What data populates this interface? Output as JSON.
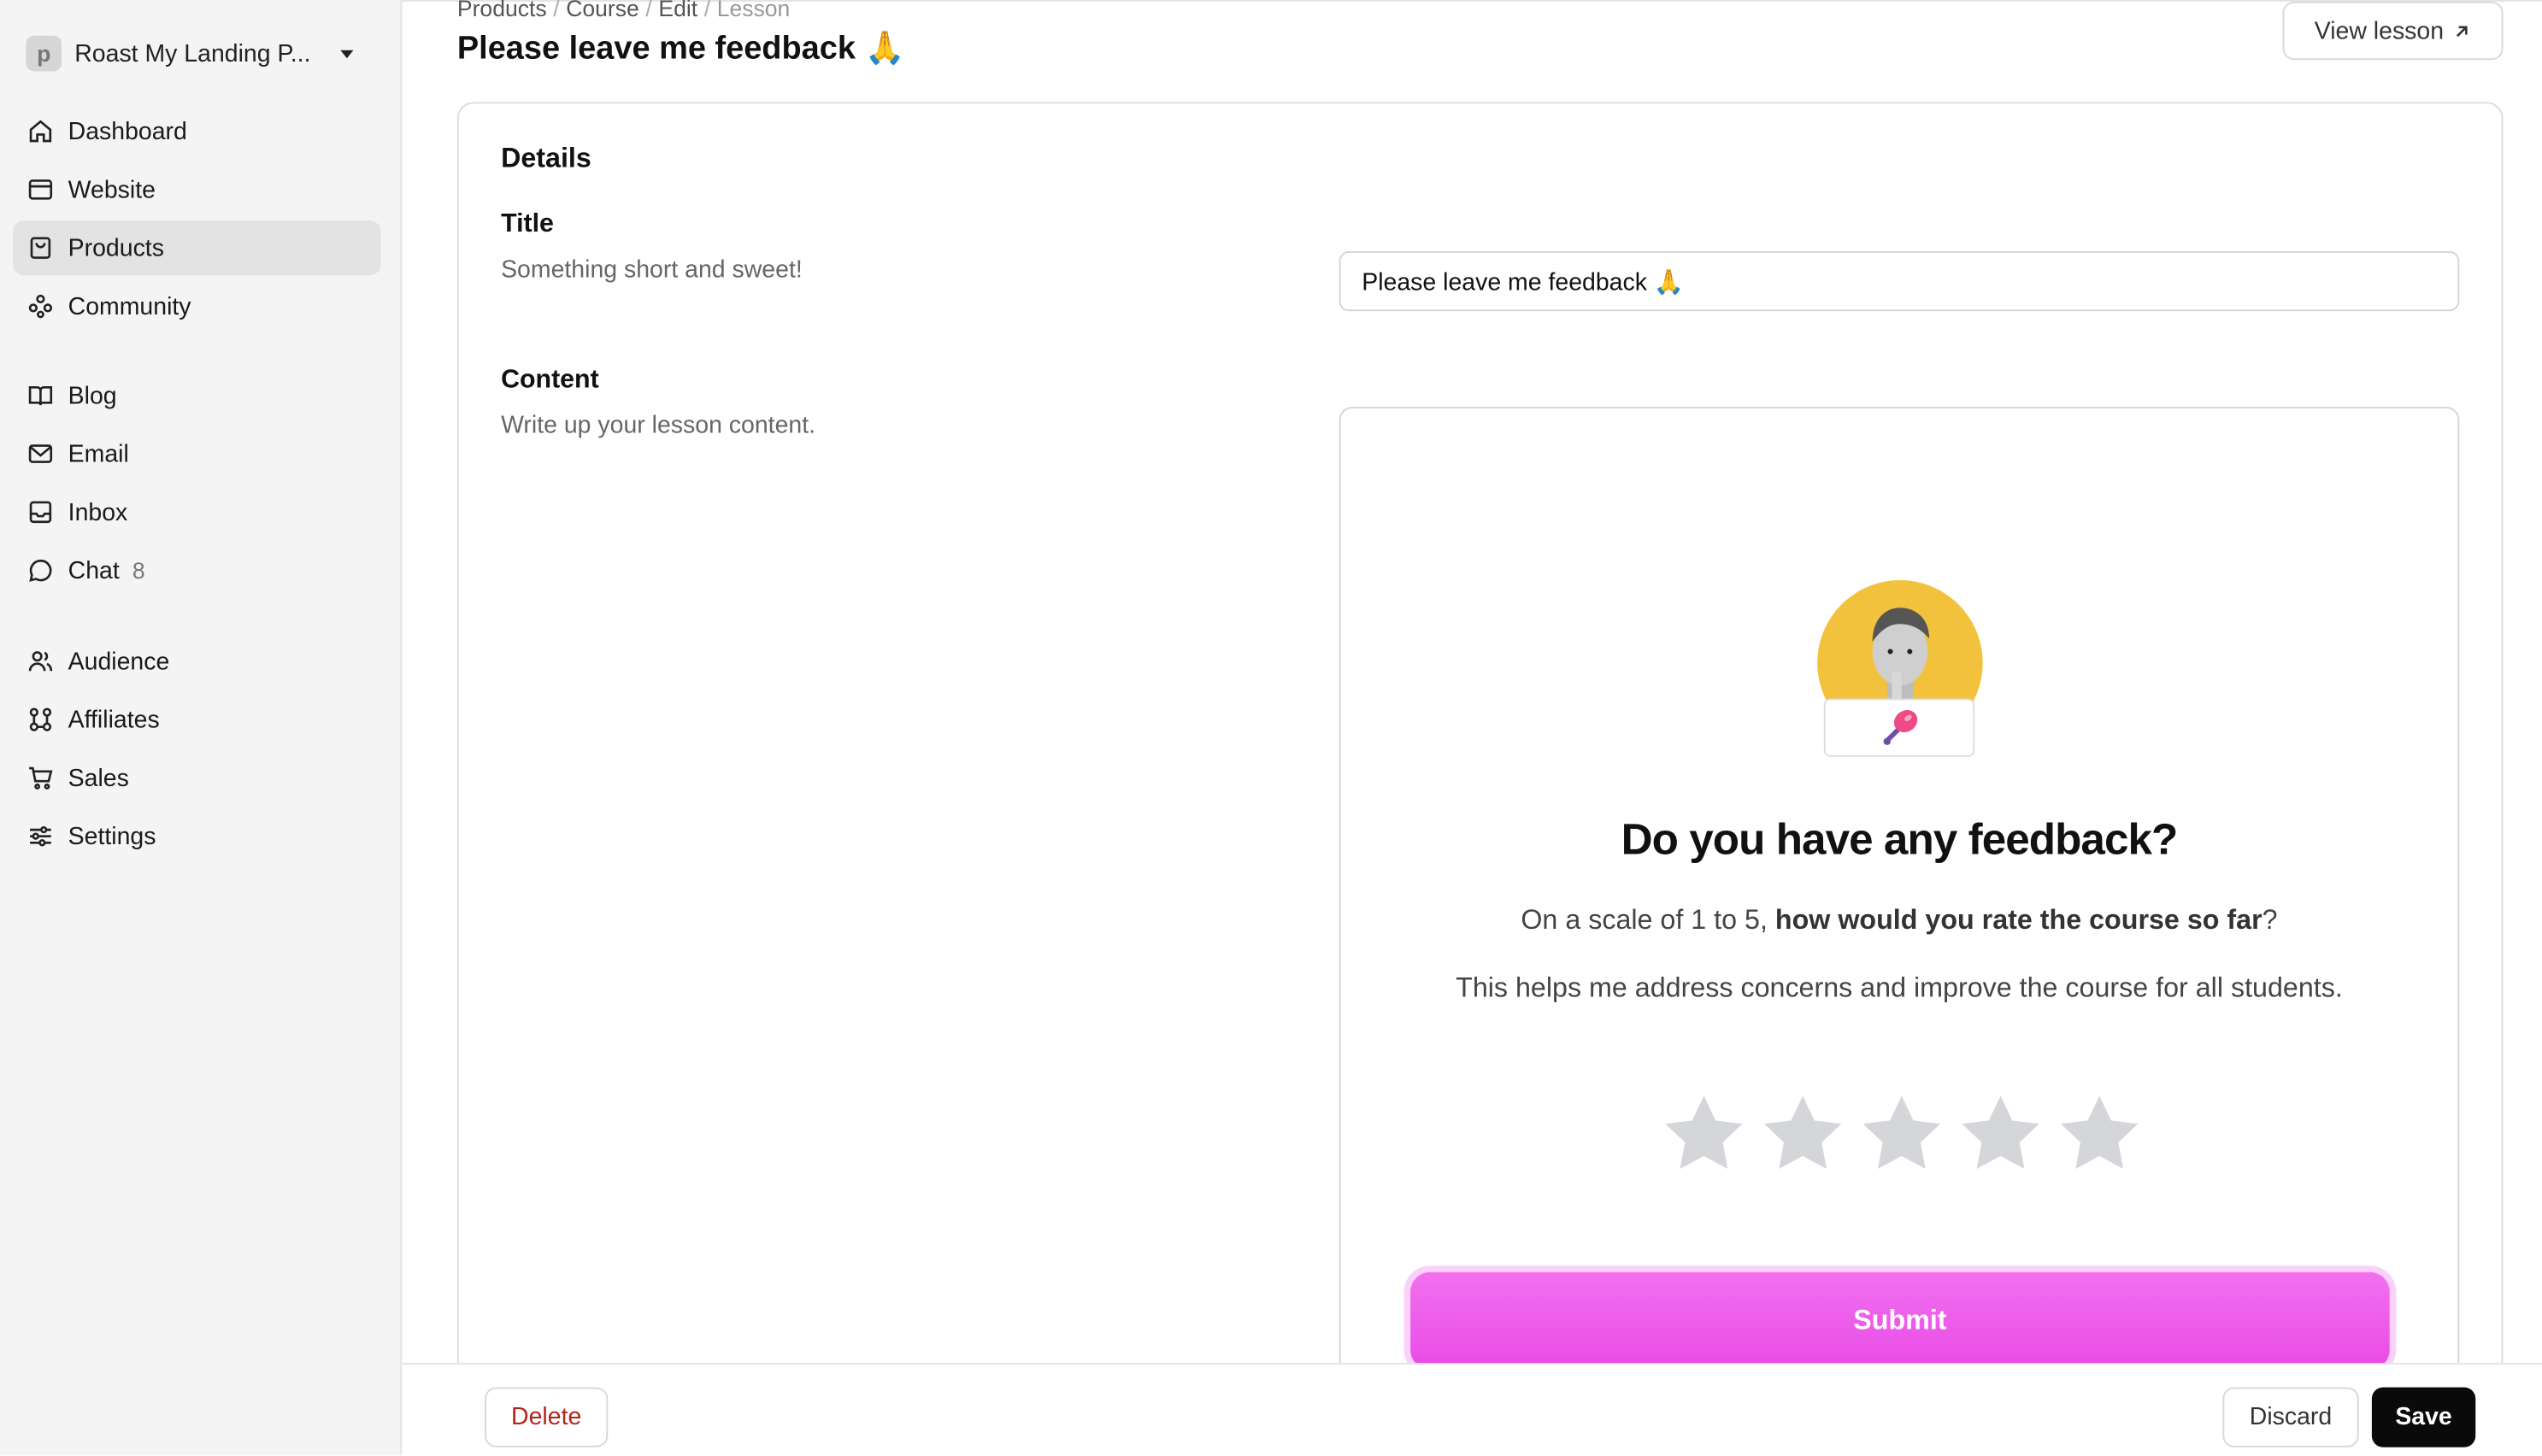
{
  "workspace": {
    "logo_letter": "p",
    "name": "Roast My Landing P..."
  },
  "nav_primary": [
    {
      "label": "Dashboard",
      "icon": "home-icon"
    },
    {
      "label": "Website",
      "icon": "browser-icon"
    },
    {
      "label": "Products",
      "icon": "bag-icon",
      "active": true
    },
    {
      "label": "Community",
      "icon": "community-icon"
    }
  ],
  "nav_secondary": [
    {
      "label": "Blog",
      "icon": "book-icon"
    },
    {
      "label": "Email",
      "icon": "mail-icon"
    },
    {
      "label": "Inbox",
      "icon": "inbox-icon"
    },
    {
      "label": "Chat",
      "icon": "chat-bubble-icon",
      "badge": "8"
    }
  ],
  "nav_tertiary": [
    {
      "label": "Audience",
      "icon": "users-icon"
    },
    {
      "label": "Affiliates",
      "icon": "affiliates-icon"
    },
    {
      "label": "Sales",
      "icon": "cart-icon"
    },
    {
      "label": "Settings",
      "icon": "sliders-icon"
    }
  ],
  "breadcrumb": [
    "Products",
    "Course",
    "Edit",
    "Lesson"
  ],
  "page_title": "Please leave me feedback 🙏",
  "view_lesson": {
    "label": "View lesson",
    "icon": "arrow-up-right-icon"
  },
  "details": {
    "heading": "Details",
    "title_label": "Title",
    "title_help": "Something short and sweet!",
    "title_value": "Please leave me feedback 🙏",
    "content_label": "Content",
    "content_help": "Write up your lesson content."
  },
  "feedback_block": {
    "heading": "Do you have any feedback?",
    "question_prefix": "On a scale of 1 to 5, ",
    "question_bold": "how would you rate the course so far",
    "question_suffix": "?",
    "note": "This helps me address concerns and improve the course for all students.",
    "rating_max": 5,
    "rating_value": 0,
    "submit_label": "Submit",
    "accent": "#ec55ea"
  },
  "footer": {
    "delete_label": "Delete",
    "discard_label": "Discard",
    "save_label": "Save"
  }
}
